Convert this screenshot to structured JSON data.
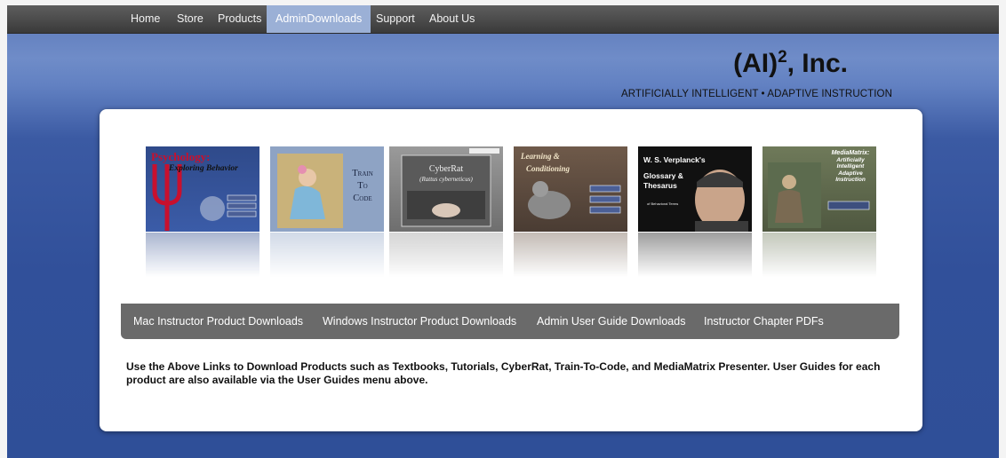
{
  "nav": {
    "items": [
      {
        "label": "Home"
      },
      {
        "label": "Store"
      },
      {
        "label": "Products"
      },
      {
        "label": "AdminDownloads",
        "active": true
      },
      {
        "label": "Support"
      },
      {
        "label": "About Us"
      }
    ]
  },
  "brand": {
    "name_prefix": "(AI)",
    "name_sup": "2",
    "name_suffix": ", Inc.",
    "tagline": "ARTIFICIALLY INTELLIGENT • ADAPTIVE INSTRUCTION"
  },
  "products": [
    {
      "name": "psychology-cover",
      "title": "Psychology:",
      "subtitle": "Exploring Behavior"
    },
    {
      "name": "train-to-code-cover",
      "title_lines": [
        "Train",
        "To",
        "Code"
      ]
    },
    {
      "name": "cyberrat-cover",
      "title": "CyberRat",
      "subtitle": "(Rattus cyberneticus)"
    },
    {
      "name": "learning-conditioning-cover",
      "title": "Learning &",
      "subtitle": "Conditioning"
    },
    {
      "name": "verplanck-glossary-cover",
      "title_lines": [
        "W. S. Verplanck's",
        "Glossary &",
        "Thesarus"
      ],
      "caption": "of Behavioral Terms"
    },
    {
      "name": "mediamatrix-cover",
      "title_lines": [
        "MediaMatrix:",
        "Artificially",
        "Intelligent",
        "Adaptive",
        "Instruction"
      ]
    }
  ],
  "links": {
    "mac": "Mac Instructor Product Downloads",
    "windows": "Windows Instructor Product Downloads",
    "admin_guide": "Admin User Guide Downloads",
    "chapter_pdfs": "Instructor Chapter PDFs"
  },
  "note": "Use the Above Links to Download Products such as Textbooks, Tutorials, CyberRat, Train-To-Code, and MediaMatrix Presenter. User Guides for each product are also available via the User Guides menu above."
}
